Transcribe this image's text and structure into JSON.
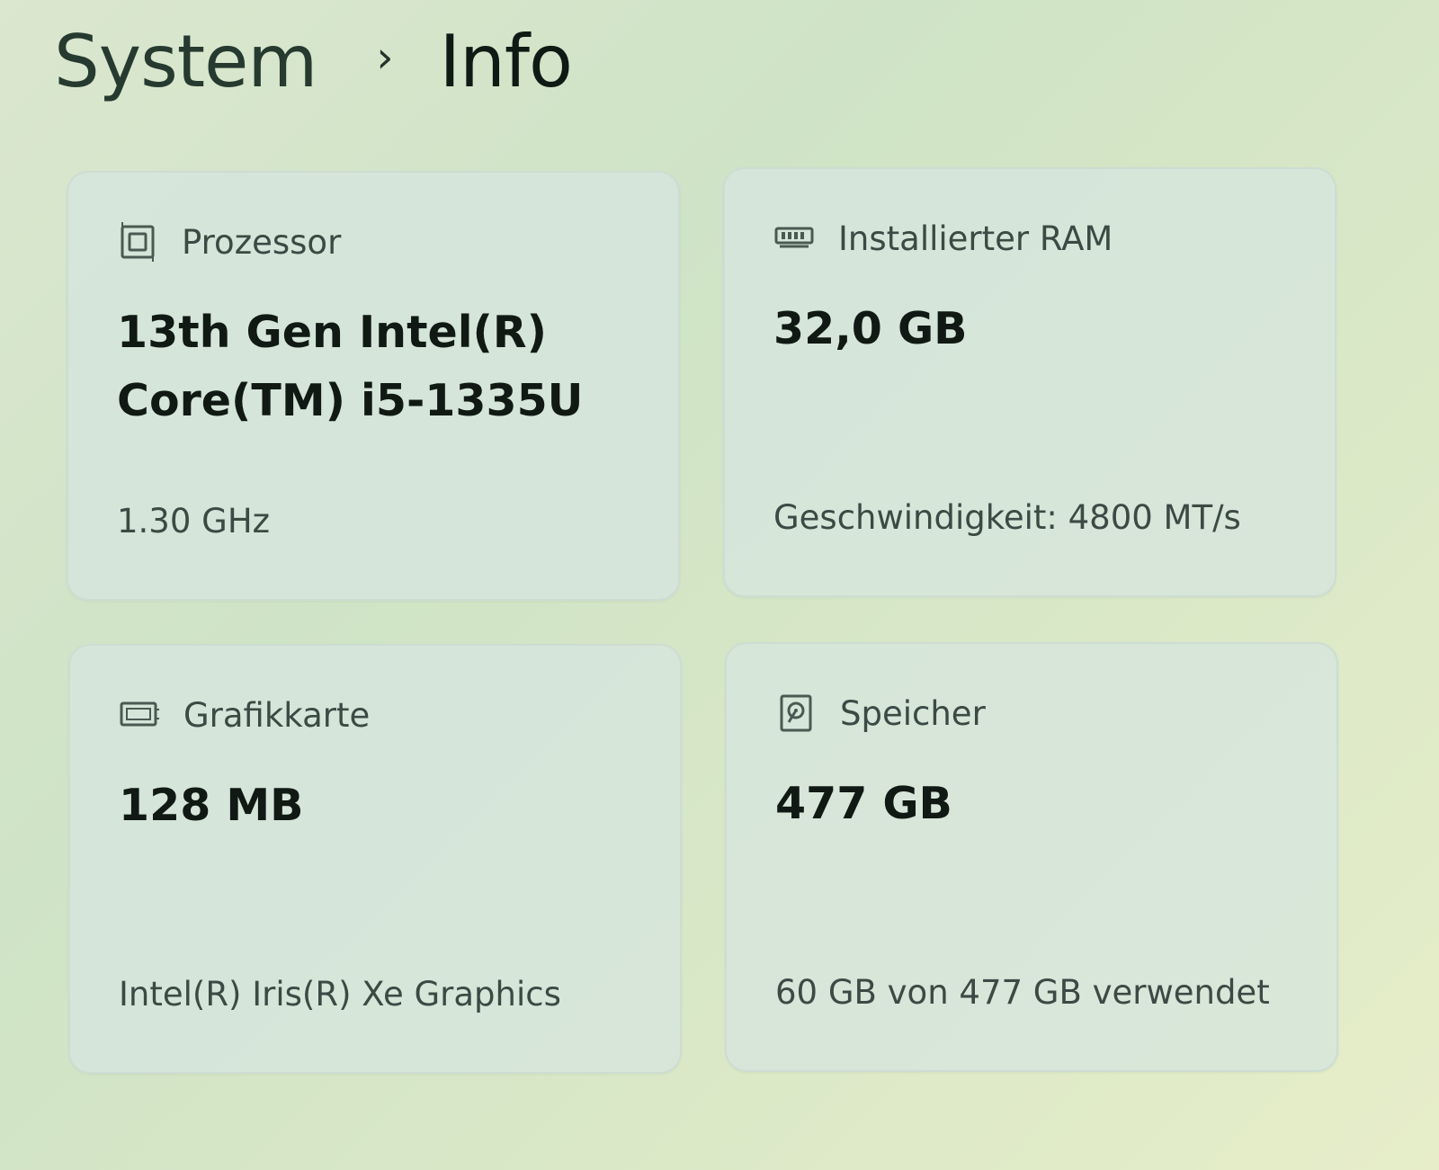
{
  "breadcrumb": {
    "parent": "System",
    "separator": "›",
    "current": "Info"
  },
  "cards": [
    {
      "icon": "processor-chip-icon",
      "label": "Prozessor",
      "value_line1": "13th Gen Intel(R)",
      "value_line2": "Core(TM) i5-1335U",
      "detail": "1.30 GHz"
    },
    {
      "icon": "ram-module-icon",
      "label": "Installierter RAM",
      "value": "32,0 GB",
      "detail": "Geschwindigkeit: 4800 MT/s"
    },
    {
      "icon": "graphics-card-icon",
      "label": "Grafikkarte",
      "value": "128 MB",
      "detail": "Intel(R) Iris(R) Xe Graphics"
    },
    {
      "icon": "storage-drive-icon",
      "label": "Speicher",
      "value": "477 GB",
      "detail": "60 GB von 477 GB verwendet"
    }
  ]
}
